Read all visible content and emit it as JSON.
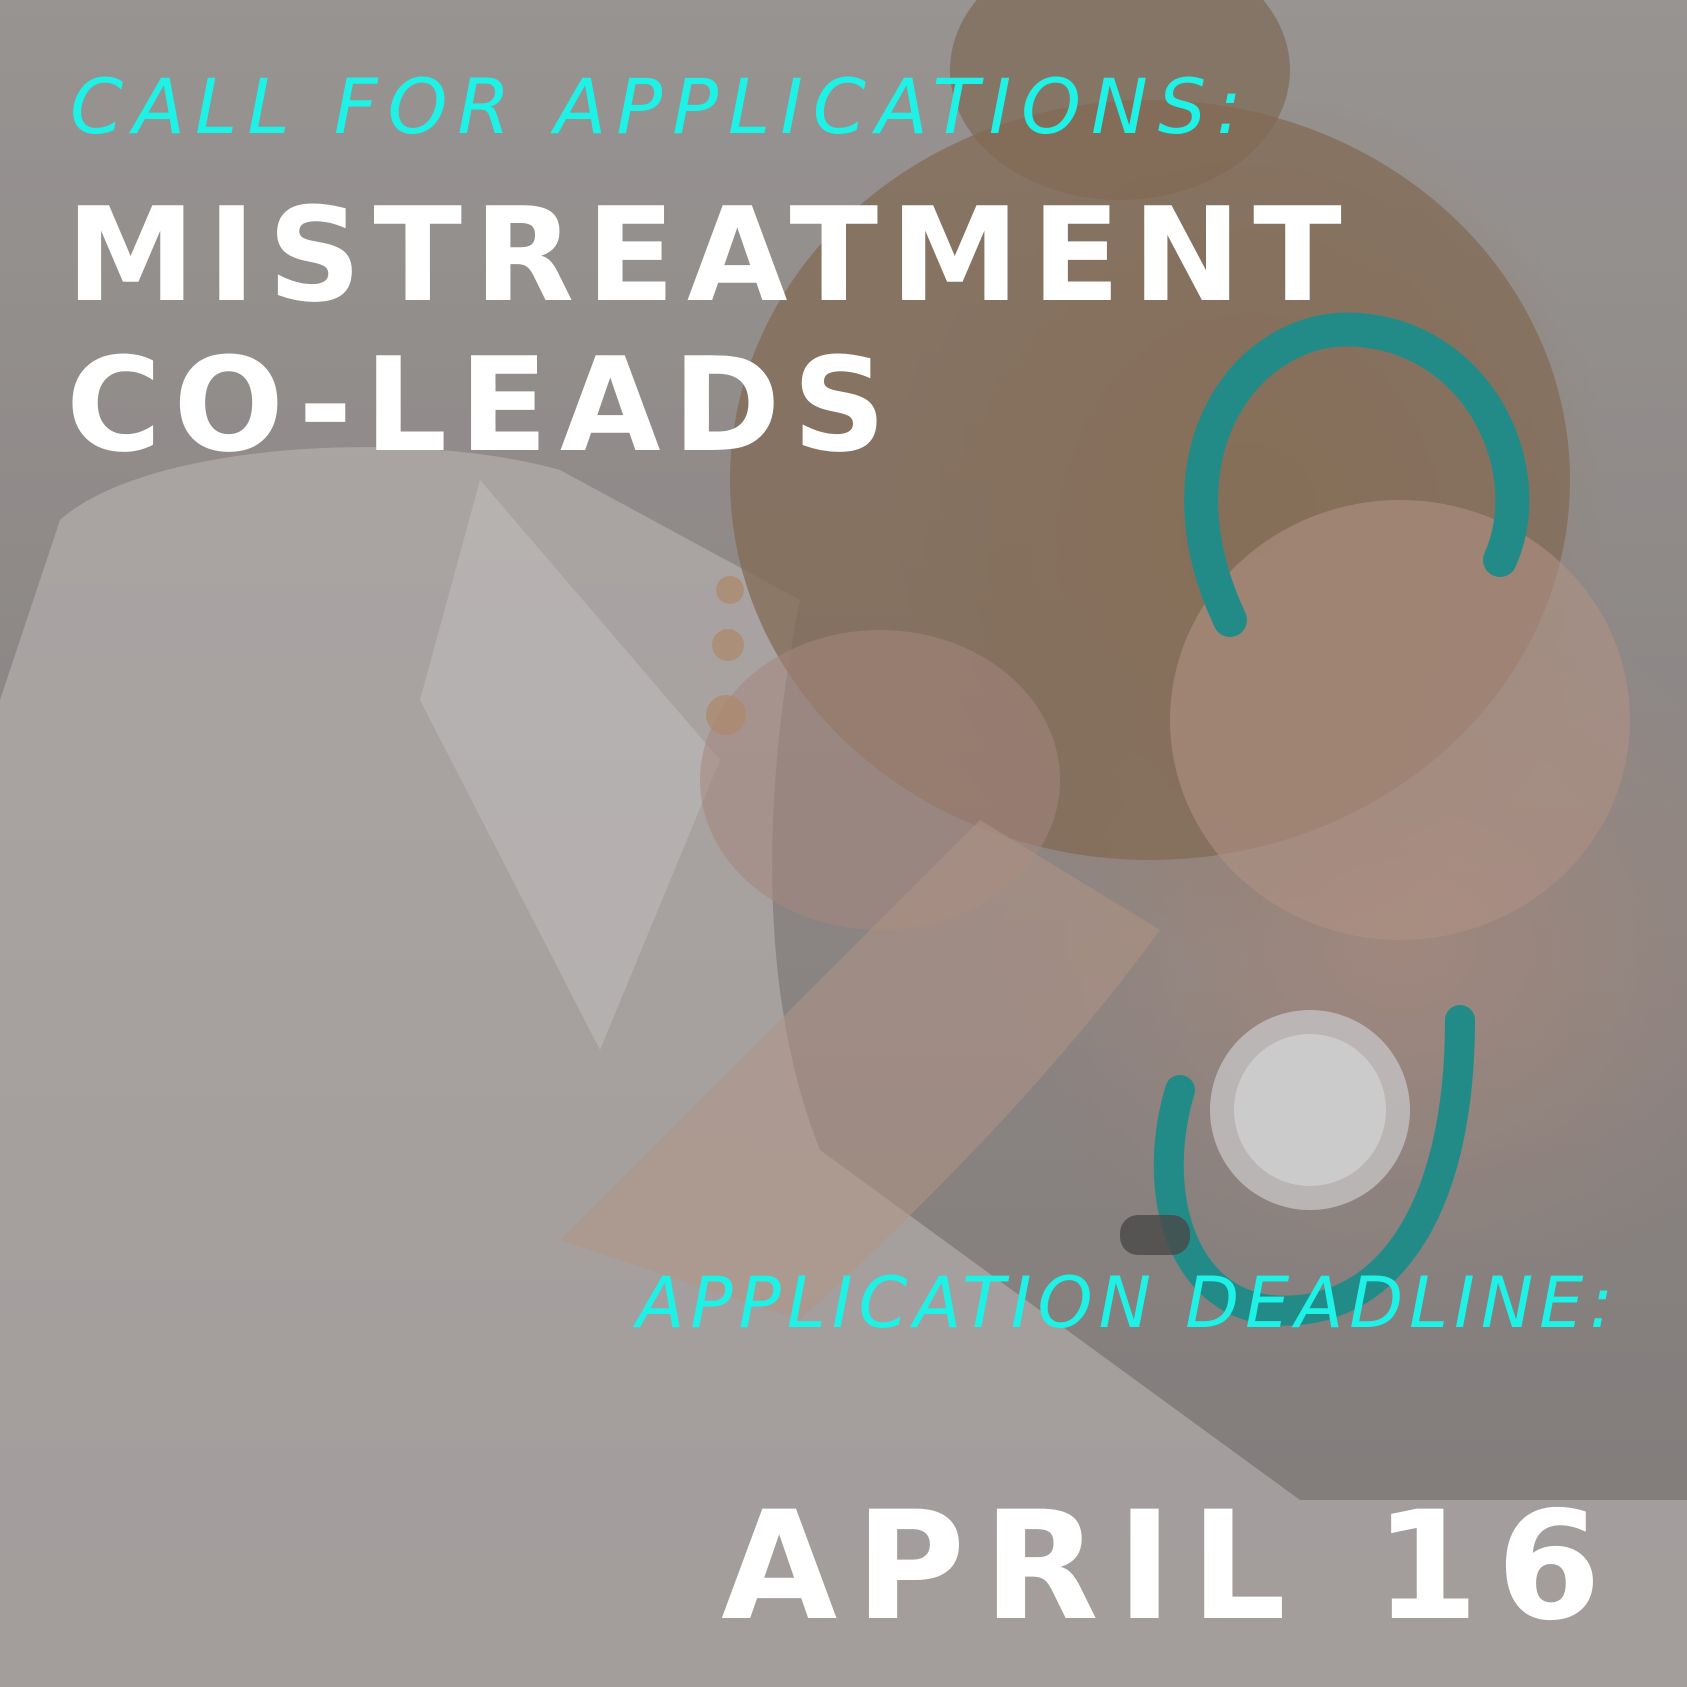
{
  "poster": {
    "kicker": "CALL FOR APPLICATIONS:",
    "headline_line1": "MISTREATMENT",
    "headline_line2": "CO-LEADS",
    "deadline_label": "APPLICATION DEADLINE:",
    "deadline_date": "APRIL 16"
  },
  "colors": {
    "accent": "#1ef2e6",
    "headline": "#ffffff",
    "stethoscope": "#1a9b98"
  },
  "background_photo": {
    "icon": "distressed-doctor-with-stethoscope-image"
  }
}
